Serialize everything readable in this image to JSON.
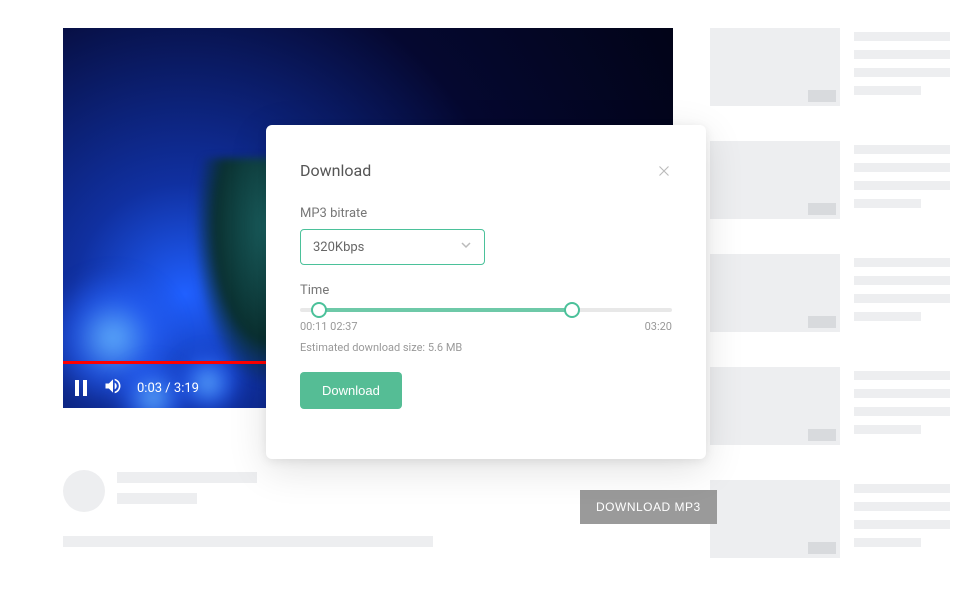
{
  "video": {
    "currentTime": "0:03",
    "duration": "3:19"
  },
  "downloadMp3Button": "DOWNLOAD MP3",
  "modal": {
    "title": "Download",
    "bitrateLabel": "MP3 bitrate",
    "bitrateValue": "320Kbps",
    "timeLabel": "Time",
    "timeStart": "00:11",
    "timeEnd": "02:37",
    "totalDuration": "03:20",
    "estimatedPrefix": "Estimated download size: ",
    "estimatedSize": "5.6 MB",
    "downloadButton": "Download"
  },
  "colors": {
    "accent": "#4bc19a",
    "skeleton": "#edeef0"
  }
}
